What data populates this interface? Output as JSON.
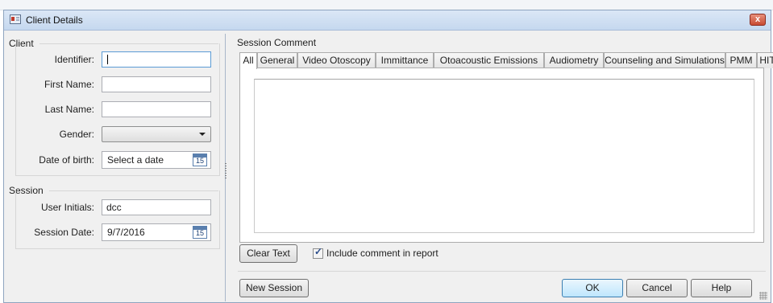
{
  "window": {
    "title": "Client Details",
    "close_symbol": "x"
  },
  "client": {
    "section_title": "Client",
    "identifier_label": "Identifier:",
    "identifier_value": "",
    "first_name_label": "First Name:",
    "first_name_value": "",
    "last_name_label": "Last Name:",
    "last_name_value": "",
    "gender_label": "Gender:",
    "gender_value": "",
    "dob_label": "Date of birth:",
    "dob_placeholder": "Select a date"
  },
  "session": {
    "section_title": "Session",
    "user_initials_label": "User Initials:",
    "user_initials_value": "dcc",
    "session_date_label": "Session Date:",
    "session_date_value": "9/7/2016"
  },
  "calendar_icon_day": "15",
  "comment": {
    "section_title": "Session Comment",
    "tabs": [
      "All",
      "General",
      "Video Otoscopy",
      "Immittance",
      "Otoacoustic Emissions",
      "Audiometry",
      "Counseling and Simulations",
      "PMM",
      "HIT"
    ],
    "active_tab": "All",
    "text": "",
    "clear_button": "Clear Text",
    "include_label": "Include comment in report",
    "include_checked_symbol": "✓"
  },
  "buttons": {
    "new_session": "New Session",
    "ok": "OK",
    "cancel": "Cancel",
    "help": "Help"
  }
}
